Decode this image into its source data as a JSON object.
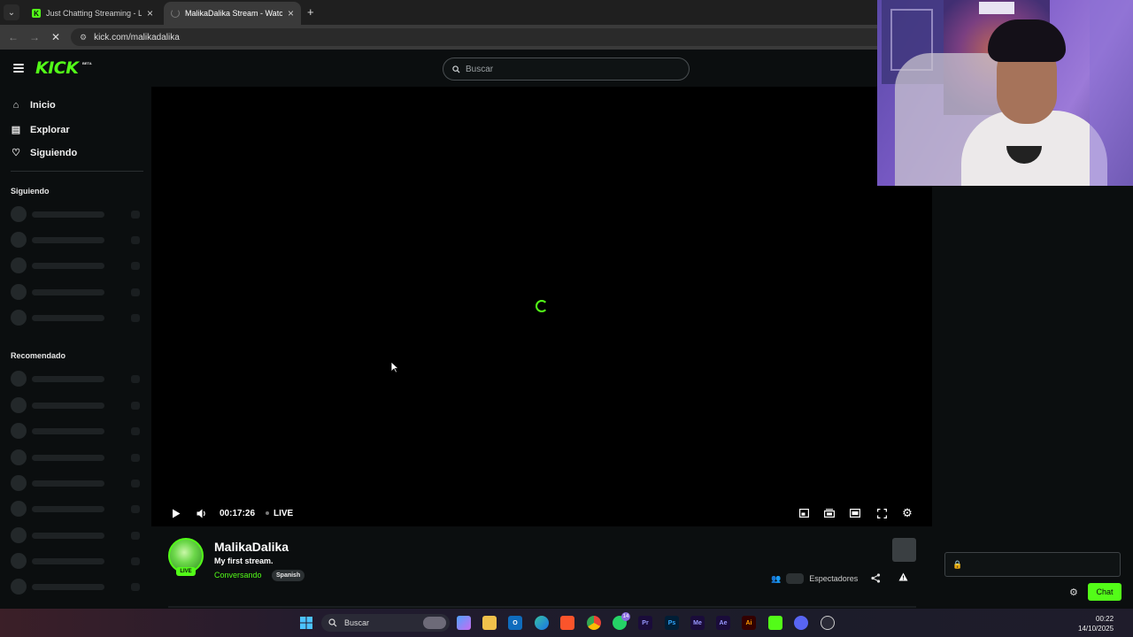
{
  "browser": {
    "tabs": [
      {
        "title": "Just Chatting Streaming - Live S",
        "active": false
      },
      {
        "title": "MalikaDalika Stream - Watch Li",
        "active": true
      }
    ],
    "new_tab": "+",
    "url": "kick.com/malikadalika"
  },
  "kick": {
    "logo": "KICK",
    "logo_badge": "BETA",
    "search_placeholder": "Buscar",
    "accent_color": "#53fc18"
  },
  "sidebar": {
    "nav": [
      {
        "label": "Inicio",
        "icon": "home-icon"
      },
      {
        "label": "Explorar",
        "icon": "explore-icon"
      },
      {
        "label": "Siguiendo",
        "icon": "heart-icon"
      }
    ],
    "following_heading": "Siguiendo",
    "recommended_heading": "Recomendado"
  },
  "player": {
    "time": "00:17:26",
    "live_label": "LIVE",
    "state": "loading"
  },
  "channel": {
    "name": "MalikaDalika",
    "title": "My first stream.",
    "category": "Conversando",
    "language": "Spanish",
    "live_badge": "LIVE",
    "viewers_label": "Espectadores"
  },
  "chat": {
    "button_label": "Chat"
  },
  "taskbar": {
    "search_label": "Buscar",
    "whatsapp_badge": "14",
    "time": "00:22",
    "date": "14/10/2025"
  }
}
